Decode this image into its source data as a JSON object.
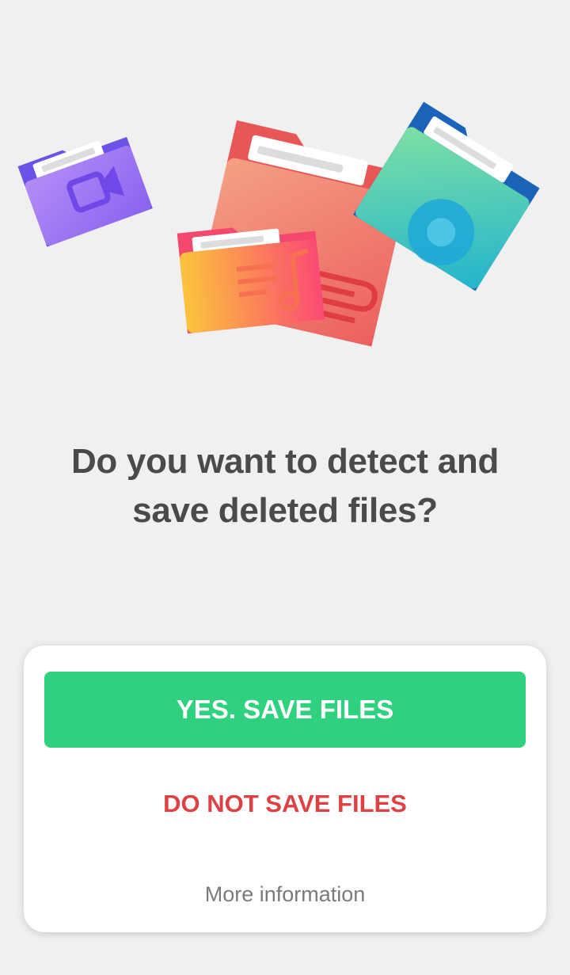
{
  "onboarding": {
    "question": "Do you want to detect and save deleted files?"
  },
  "actions": {
    "confirm_label": "YES. SAVE FILES",
    "decline_label": "DO NOT SAVE FILES",
    "more_info_label": "More information"
  },
  "illustration": {
    "folders": [
      "video-folder-icon",
      "document-folder-icon",
      "music-folder-icon",
      "photo-folder-icon"
    ]
  },
  "colors": {
    "background": "#f0f0f0",
    "confirm": "#2fd17f",
    "decline": "#dd4143",
    "headline": "#4a4a4a",
    "link": "#7a7a7a"
  }
}
